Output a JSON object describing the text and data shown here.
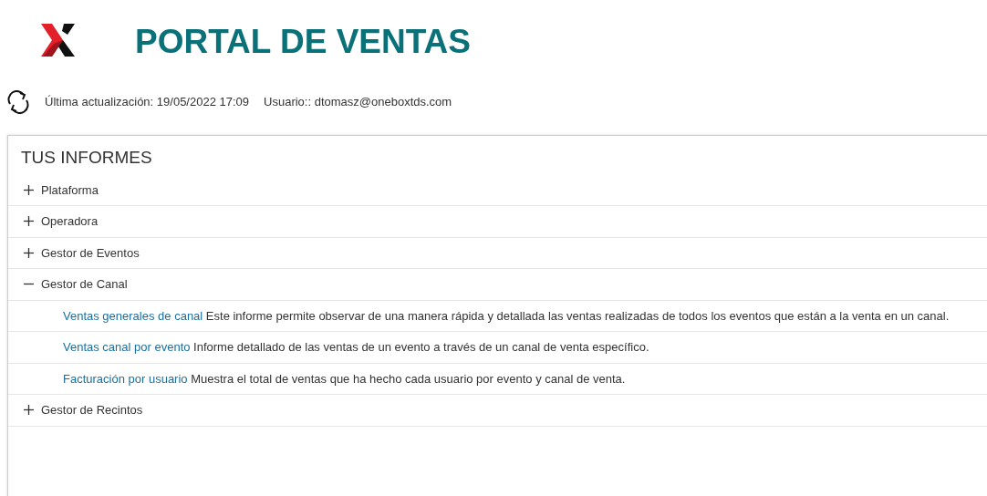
{
  "header": {
    "title": "PORTAL DE VENTAS"
  },
  "info": {
    "last_update": "Última actualización: 19/05/2022 17:09",
    "user": "Usuario:: dtomasz@oneboxtds.com"
  },
  "panel": {
    "title": "TUS INFORMES",
    "sections": [
      {
        "label": "Plataforma",
        "expanded": false
      },
      {
        "label": "Operadora",
        "expanded": false
      },
      {
        "label": "Gestor de Eventos",
        "expanded": false
      },
      {
        "label": "Gestor de Canal",
        "expanded": true,
        "children": [
          {
            "link": "Ventas generales de canal",
            "description": "Este informe permite observar de una manera rápida y detallada las ventas realizadas de todos los eventos que están a la venta en un canal."
          },
          {
            "link": "Ventas canal por evento",
            "description": "Informe detallado de las ventas de un evento a través de un canal de venta específico."
          },
          {
            "link": "Facturación por usuario",
            "description": "Muestra el total de ventas que ha hecho cada usuario por evento y canal de venta."
          }
        ]
      },
      {
        "label": "Gestor de Recintos",
        "expanded": false
      }
    ]
  }
}
